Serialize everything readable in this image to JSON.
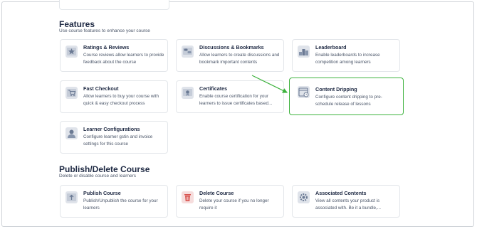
{
  "colors": {
    "highlight": "#3db23d",
    "title": "#1f2a44",
    "text": "#4a5568",
    "icon_bg": "#dfe3ea"
  },
  "features": {
    "title": "Features",
    "subtitle": "Use course features to enhance your course",
    "cards": [
      {
        "title": "Ratings & Reviews",
        "desc": "Course reviews allow learners to provide feedback about the course",
        "icon": "star-review-icon"
      },
      {
        "title": "Discussions & Bookmarks",
        "desc": "Allow learners to create discussions and bookmark important contents",
        "icon": "discussion-icon"
      },
      {
        "title": "Leaderboard",
        "desc": "Enable leaderboards to increase competition among learners",
        "icon": "leaderboard-icon"
      },
      {
        "title": "Fast Checkout",
        "desc": "Allow learners to buy your course with quick & easy checkout process",
        "icon": "cart-icon"
      },
      {
        "title": "Certificates",
        "desc": "Enable course certification for your learners to issue certificates based...",
        "icon": "certificate-icon"
      },
      {
        "title": "Content Dripping",
        "desc": "Configure content dripping to pre-schedule release of lessons",
        "icon": "calendar-clock-icon"
      },
      {
        "title": "Learner Configurations",
        "desc": "Configure learner gstin and invoice settings for this course",
        "icon": "user-config-icon"
      }
    ]
  },
  "publish": {
    "title": "Publish/Delete Course",
    "subtitle": "Delete or disable course and learners",
    "cards": [
      {
        "title": "Publish Course",
        "desc": "Publish/Unpublish the course for your learners",
        "icon": "upload-icon"
      },
      {
        "title": "Delete Course",
        "desc": "Delete your course if you no longer require it",
        "icon": "trash-icon"
      },
      {
        "title": "Associated Contents",
        "desc": "View all contents your product is associated with. Be it a bundle,...",
        "icon": "gear-icon"
      }
    ]
  }
}
